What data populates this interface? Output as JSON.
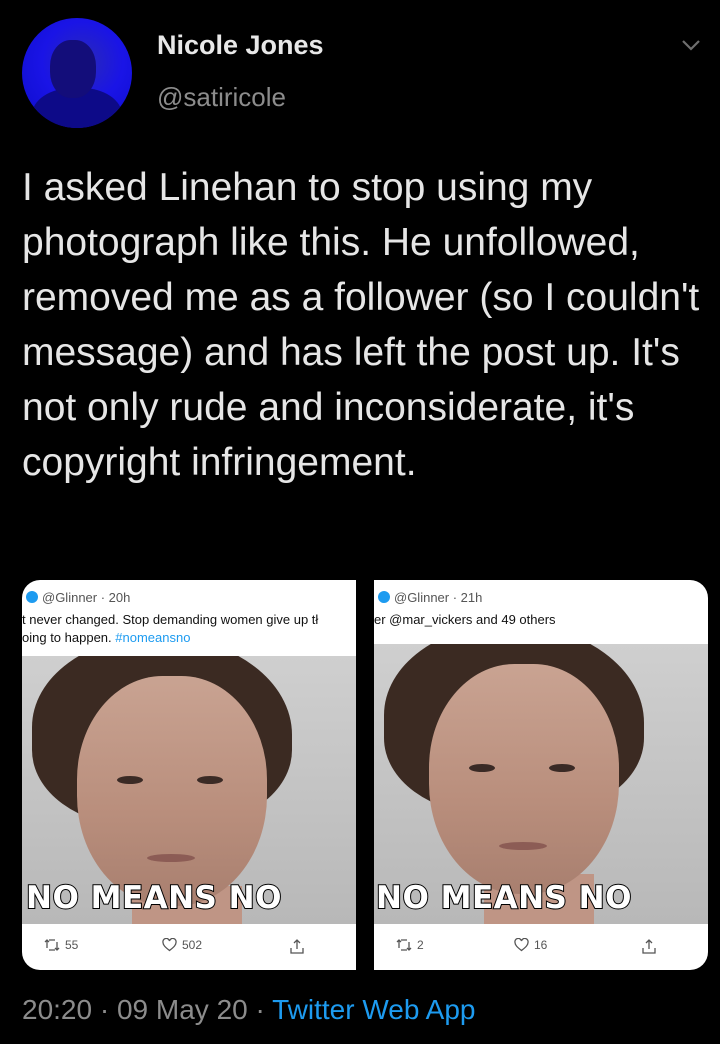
{
  "author": {
    "name": "Nicole Jones",
    "handle": "@satiricole"
  },
  "tweet": {
    "text": "I asked Linehan to stop using my photograph like this. He unfollowed, removed me as a follower (so I couldn't message) and has left the post up. It's not only rude and inconsiderate, it's copyright infringement."
  },
  "media": [
    {
      "handle": "@Glinner",
      "time": "20h",
      "line1": "t never changed. Stop demanding women give up tł",
      "line2_text": "oing to happen.",
      "line2_hashtag": "#nomeansno",
      "caption": "NO MEANS NO",
      "retweets": "55",
      "likes": "502"
    },
    {
      "handle": "@Glinner",
      "time": "21h",
      "line1_link": "er @mar_vickers and 49 others",
      "caption": "NO MEANS NO",
      "retweets": "2",
      "likes": "16"
    }
  ],
  "footer": {
    "time": "20:20",
    "date": "09 May 20",
    "separator": "·",
    "app": "Twitter Web App"
  },
  "colors": {
    "background": "#000000",
    "link": "#1d9bf0",
    "secondary_text": "#8c8c8c"
  }
}
